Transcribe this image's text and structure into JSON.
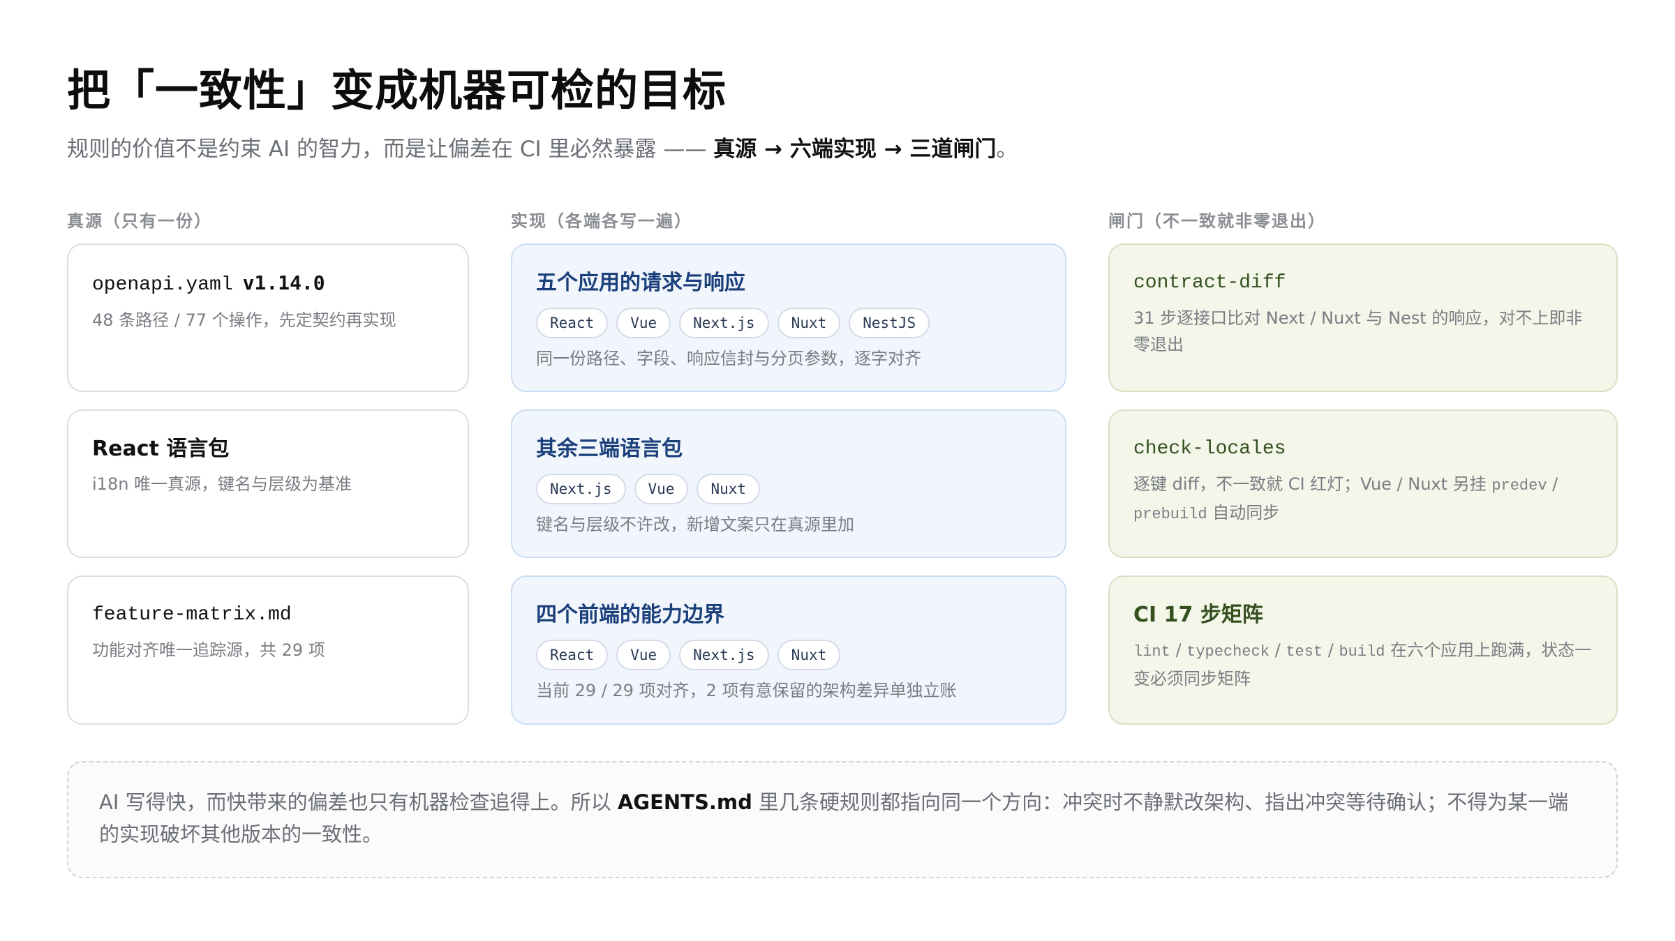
{
  "title": "把「一致性」变成机器可检的目标",
  "subtitle": {
    "lead": "规则的价值不是约束 AI 的智力，而是让偏差在 CI 里必然暴露 —— ",
    "emph": "真源 → 六端实现 → 三道闸门",
    "tail": "。"
  },
  "columns": {
    "source": "真源（只有一份）",
    "impl": "实现（各端各写一遍）",
    "gates": "闸门（不一致就非零退出）"
  },
  "source_cards": [
    {
      "title": "openapi.yaml",
      "version": "v1.14.0",
      "desc": "48 条路径 / 77 个操作，先定契约再实现"
    },
    {
      "title": "React 语言包",
      "desc": "i18n 唯一真源，键名与层级为基准"
    },
    {
      "title": "feature-matrix.md",
      "desc": "功能对齐唯一追踪源，共 29 项"
    }
  ],
  "impl_cards": [
    {
      "title": "五个应用的请求与响应",
      "tags": [
        "React",
        "Vue",
        "Next.js",
        "Nuxt",
        "NestJS"
      ],
      "desc": "同一份路径、字段、响应信封与分页参数，逐字对齐"
    },
    {
      "title": "其余三端语言包",
      "tags": [
        "Next.js",
        "Vue",
        "Nuxt"
      ],
      "desc": "键名与层级不许改，新增文案只在真源里加"
    },
    {
      "title": "四个前端的能力边界",
      "tags": [
        "React",
        "Vue",
        "Next.js",
        "Nuxt"
      ],
      "desc": "当前 29 / 29 项对齐，2 项有意保留的架构差异单独立账"
    }
  ],
  "gate_cards": [
    {
      "title": "contract-diff",
      "desc": "31 步逐接口比对 Next / Nuxt 与 Nest 的响应，对不上即非零退出"
    },
    {
      "title": "check-locales",
      "desc_a": "逐键 diff，不一致就 CI 红灯；Vue / Nuxt 另挂 ",
      "code_a": "predev",
      "desc_b": " / ",
      "code_b": "prebuild",
      "desc_c": " 自动同步"
    },
    {
      "title": "CI 17 步矩阵",
      "code_1": "lint",
      "sep_1": " / ",
      "code_2": "typecheck",
      "sep_2": " / ",
      "code_3": "test",
      "sep_3": " / ",
      "code_4": "build",
      "desc_tail": " 在六个应用上跑满，状态一变必须同步矩阵"
    }
  ],
  "footer": {
    "lead": "AI 写得快，而快带来的偏差也只有机器检查追得上。所以 ",
    "emph": "AGENTS.md",
    "tail": " 里几条硬规则都指向同一个方向：冲突时不静默改架构、指出冲突等待确认；不得为某一端的实现破坏其他版本的一致性。"
  },
  "colors": {
    "blue_card_bg": "#f1f6fc",
    "green_card_bg": "#f3f6e9",
    "blue_title": "#1a3f7a",
    "green_title": "#34501f"
  }
}
